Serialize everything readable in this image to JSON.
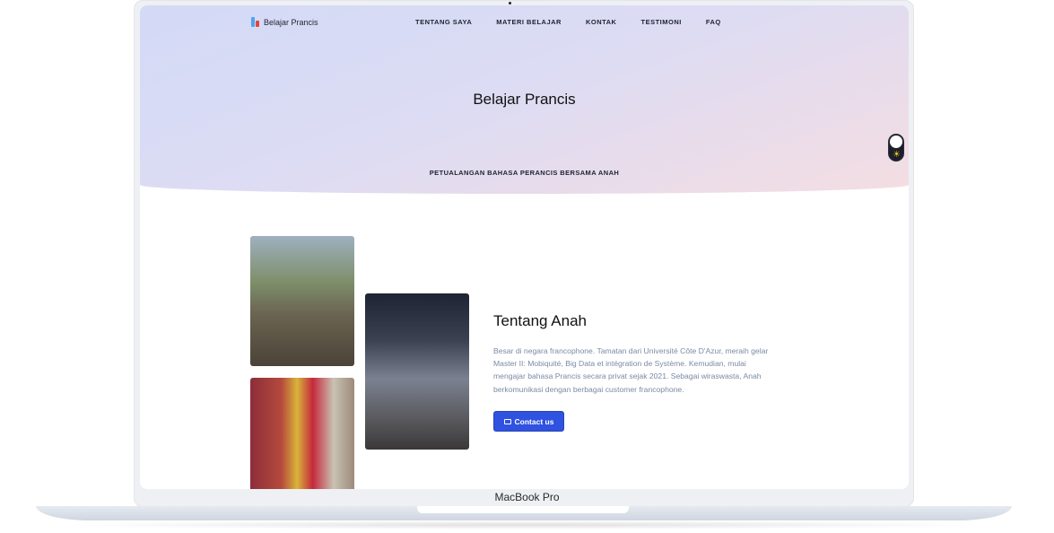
{
  "device": {
    "label": "MacBook Pro"
  },
  "nav": {
    "logo_text": "Belajar Prancis",
    "items": [
      "TENTANG SAYA",
      "MATERI BELAJAR",
      "KONTAK",
      "TESTIMONI",
      "FAQ"
    ]
  },
  "hero": {
    "title": "Belajar Prancis",
    "subtitle": "PETUALANGAN BAHASA PERANCIS BERSAMA ANAH"
  },
  "about": {
    "title": "Tentang Anah",
    "text": "Besar di negara francophone. Tamatan dari Université Côte D'Azur, meraih gelar Master II: Mobiquité, Big Data et intégration de Système. Kemudian, mulai mengajar bahasa Prancis secara privat sejak 2021. Sebagai wiraswasta, Anah berkomunikasi dengan berbagai customer francophone.",
    "button_label": "Contact us"
  },
  "theme_toggle": {
    "icon": "sun-icon"
  },
  "colors": {
    "accent": "#2f52e0",
    "body_text": "#7b8aa6"
  }
}
